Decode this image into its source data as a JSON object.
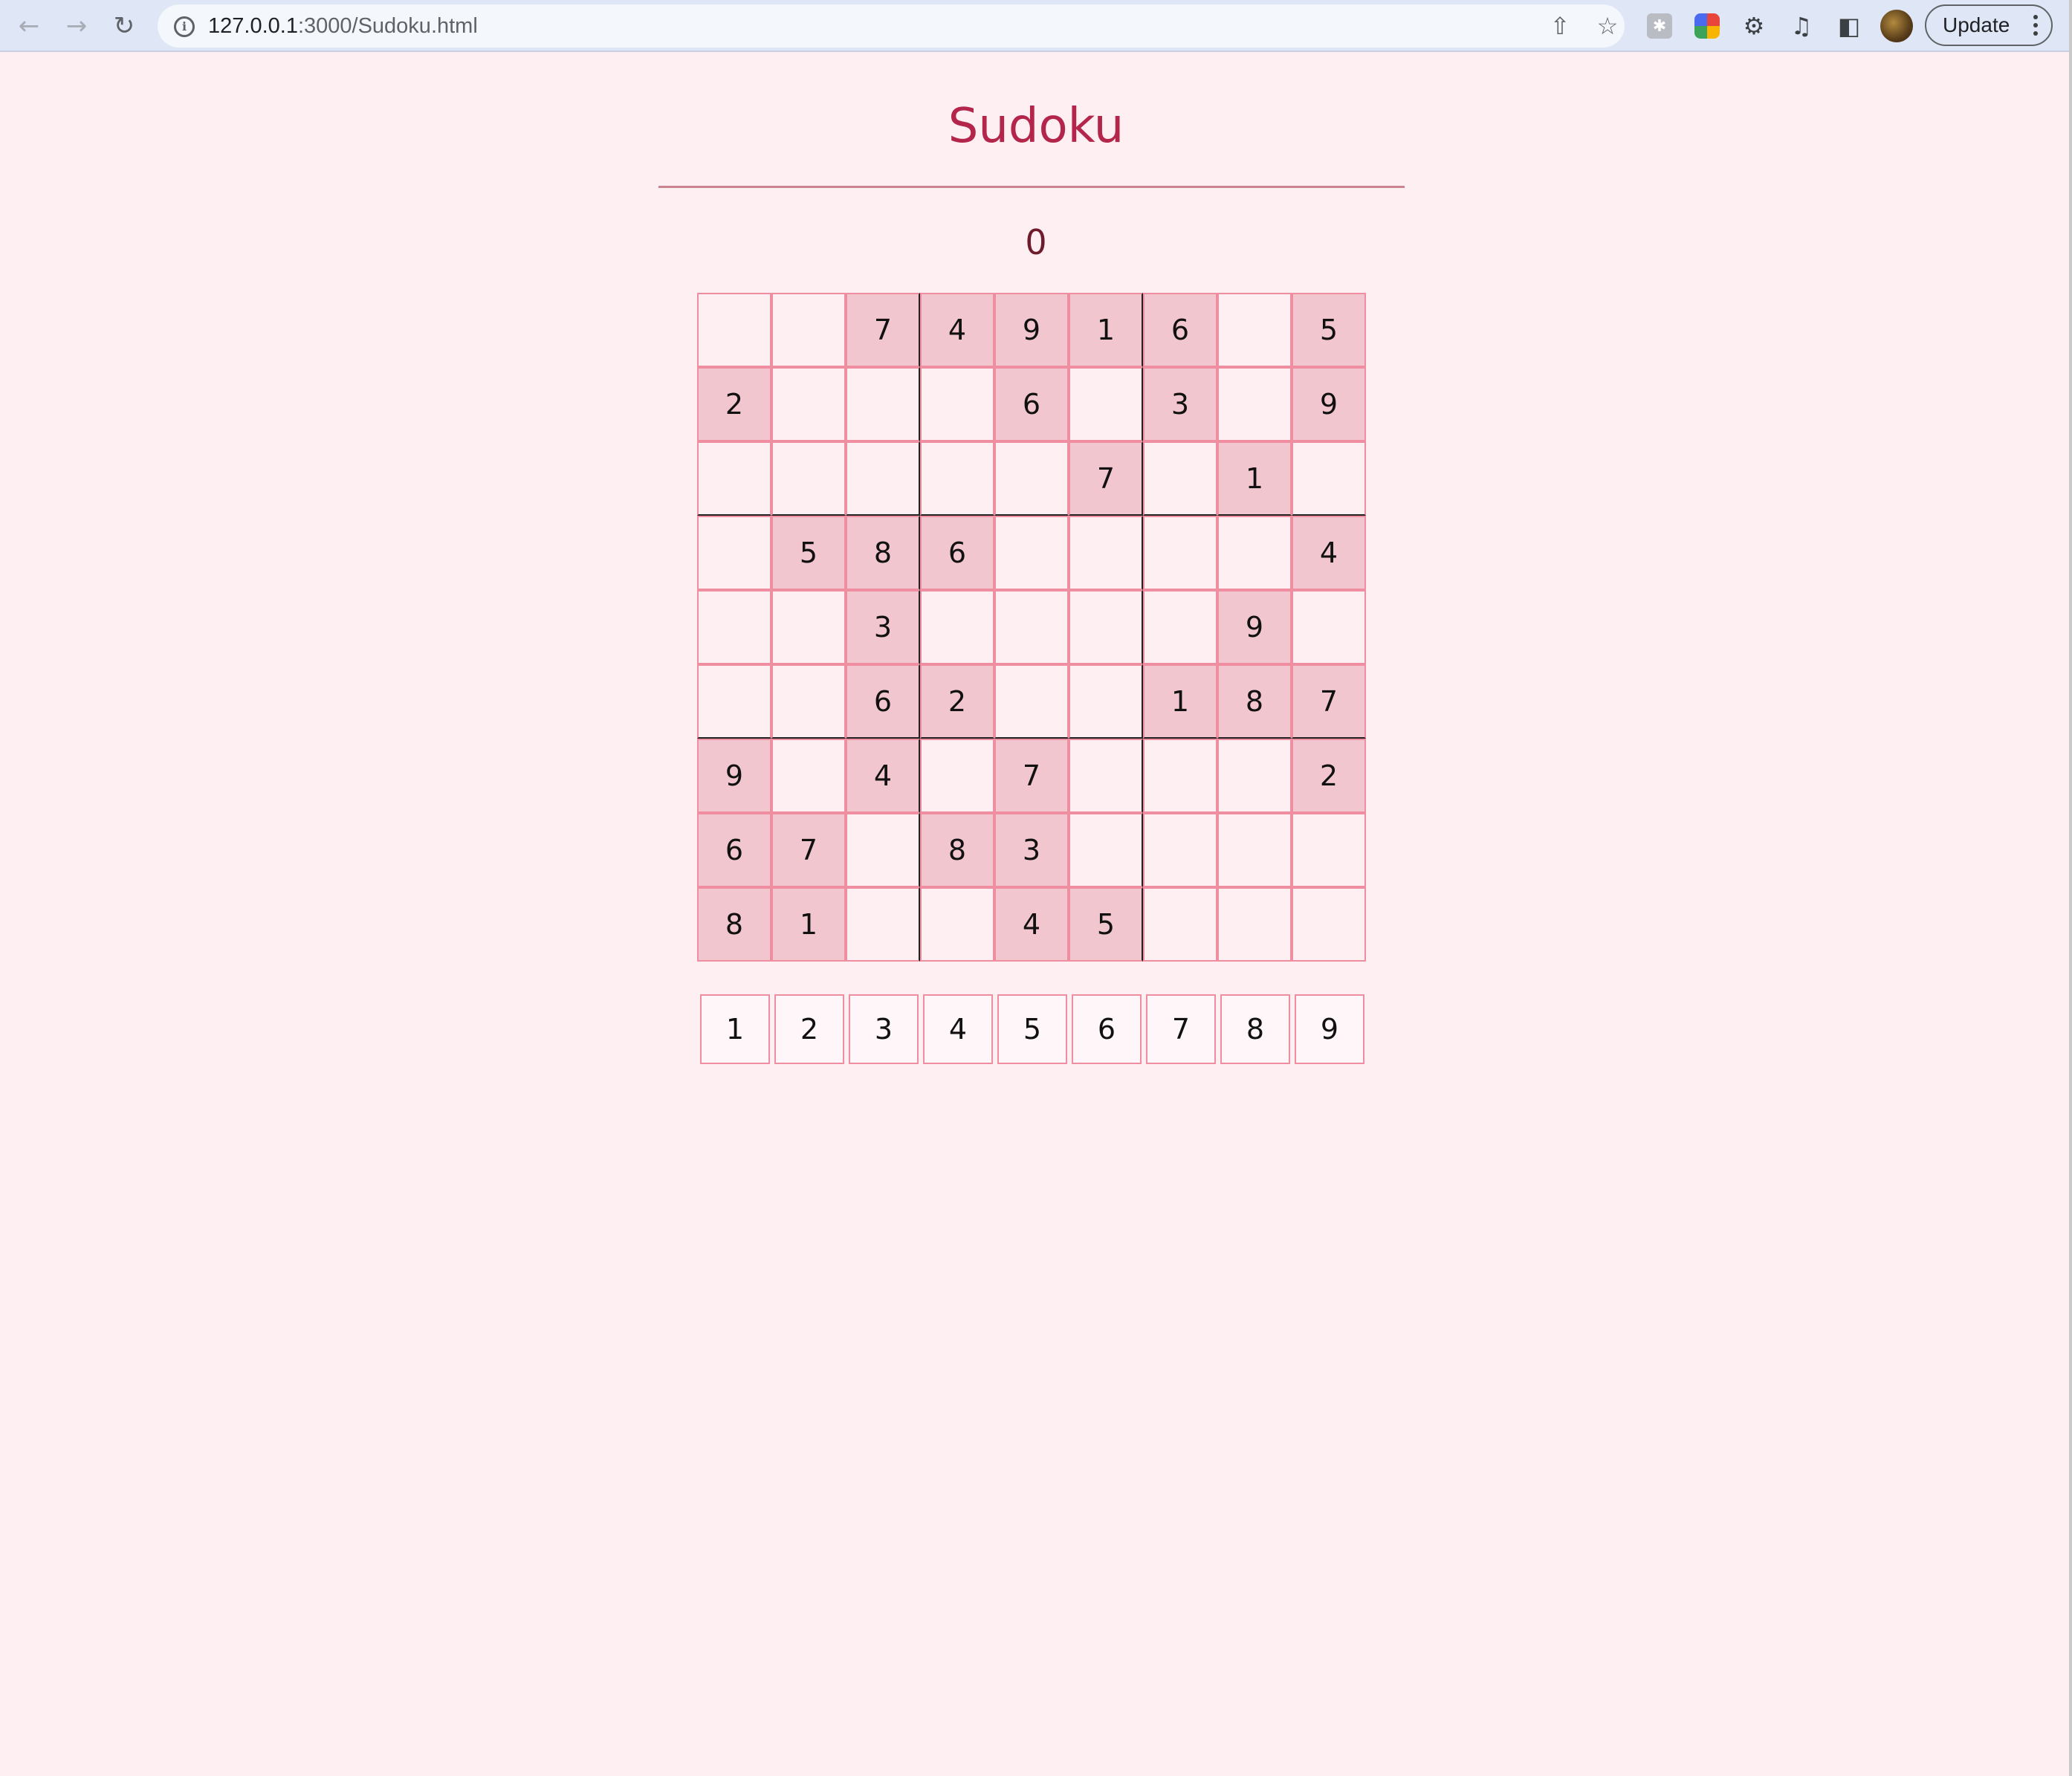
{
  "browser": {
    "url_host": "127.0.0.1",
    "url_path": ":3000/Sudoku.html",
    "update_label": "Update",
    "icons": [
      "back-icon",
      "forward-icon",
      "reload-icon",
      "info-icon",
      "share-icon",
      "star-icon",
      "extension-icon",
      "puzzle-icon",
      "media-icon",
      "side-panel-icon",
      "kebab-menu-icon"
    ]
  },
  "page": {
    "title": "Sudoku",
    "errors": "0"
  },
  "board": [
    [
      "",
      "",
      "7",
      "4",
      "9",
      "1",
      "6",
      "",
      "5"
    ],
    [
      "2",
      "",
      "",
      "",
      "6",
      "",
      "3",
      "",
      "9"
    ],
    [
      "",
      "",
      "",
      "",
      "",
      "7",
      "",
      "1",
      ""
    ],
    [
      "",
      "5",
      "8",
      "6",
      "",
      "",
      "",
      "",
      "4"
    ],
    [
      "",
      "",
      "3",
      "",
      "",
      "",
      "",
      "9",
      ""
    ],
    [
      "",
      "",
      "6",
      "2",
      "",
      "",
      "1",
      "8",
      "7"
    ],
    [
      "9",
      "",
      "4",
      "",
      "7",
      "",
      "",
      "",
      "2"
    ],
    [
      "6",
      "7",
      "",
      "8",
      "3",
      "",
      "",
      "",
      ""
    ],
    [
      "8",
      "1",
      "",
      "",
      "4",
      "5",
      "",
      "",
      ""
    ]
  ],
  "digits": [
    "1",
    "2",
    "3",
    "4",
    "5",
    "6",
    "7",
    "8",
    "9"
  ],
  "colors": {
    "background": "#fdeff2",
    "title": "#b3254a",
    "given_cell": "#f2c6cf",
    "cell_border": "#ef8ea1",
    "box_border": "#222222"
  }
}
